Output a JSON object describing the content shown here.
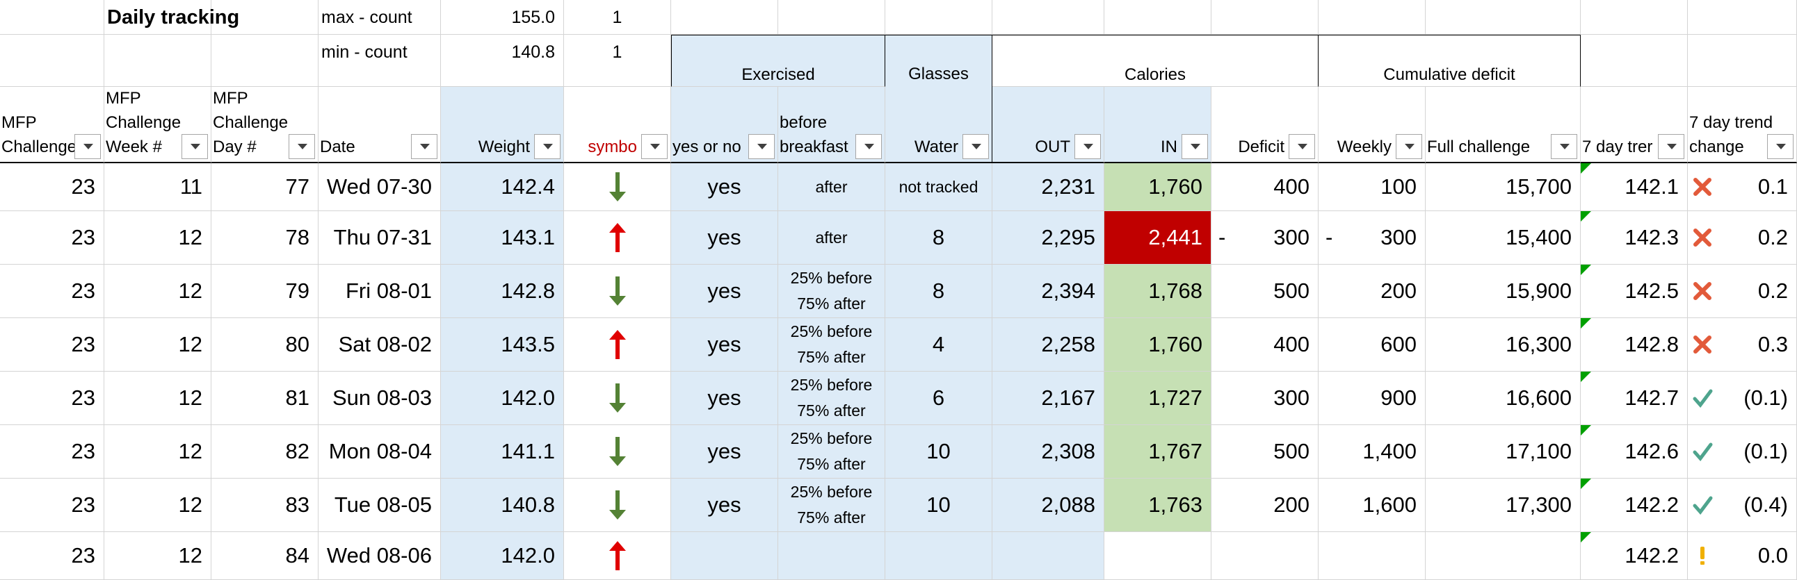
{
  "title": "Daily tracking",
  "summary": [
    {
      "label": "max - count",
      "value": "155.0",
      "count": "1"
    },
    {
      "label": "min - count",
      "value": "140.8",
      "count": "1"
    }
  ],
  "groups": {
    "exercised": "Exercised",
    "glasses": "Glasses",
    "calories": "Calories",
    "cumulative": "Cumulative deficit"
  },
  "headers": {
    "challenge": [
      "MFP",
      "Challenge"
    ],
    "week": [
      "MFP",
      "Challenge",
      "Week #"
    ],
    "day": [
      "MFP",
      "Challenge",
      "Day #"
    ],
    "date": "Date",
    "weight": "Weight",
    "symbol": "symbo",
    "yesno": "yes or no",
    "before": [
      "before",
      "breakfast"
    ],
    "water": "Water",
    "out": "OUT",
    "in": "IN",
    "deficit": "Deficit",
    "weekly": "Weekly",
    "full": "Full challenge",
    "trend": "7 day trer",
    "change": [
      "7 day trend",
      "change"
    ]
  },
  "colors": {
    "header_red": "#c00000",
    "up_arrow": "#e00000",
    "down_arrow": "#548235",
    "x_mark": "#e25a3a",
    "check": "#4ea48d",
    "warn": "#f0b000",
    "blue_fill": "#ddebf7",
    "green_fill": "#c6e0b4",
    "red_fill": "#c00000"
  },
  "rows": [
    {
      "challenge": "23",
      "week": "11",
      "day": "77",
      "date": "Wed 07-30",
      "weight": "142.4",
      "symbol": "down-arrow-icon",
      "exercised": "yes",
      "timing": [
        "after"
      ],
      "water": "not tracked",
      "out": "2,231",
      "in": "1,760",
      "in_status": "good",
      "deficit": "400",
      "deficit_neg": "",
      "weekly": "100",
      "weekly_neg": "",
      "full": "15,700",
      "trend": "142.1",
      "trend_icon": "x-mark-icon",
      "change": "0.1"
    },
    {
      "challenge": "23",
      "week": "12",
      "day": "78",
      "date": "Thu 07-31",
      "weight": "143.1",
      "symbol": "up-arrow-icon",
      "exercised": "yes",
      "timing": [
        "after"
      ],
      "water": "8",
      "out": "2,295",
      "in": "2,441",
      "in_status": "bad",
      "deficit": "300",
      "deficit_neg": "-",
      "weekly": "300",
      "weekly_neg": "-",
      "full": "15,400",
      "trend": "142.3",
      "trend_icon": "x-mark-icon",
      "change": "0.2"
    },
    {
      "challenge": "23",
      "week": "12",
      "day": "79",
      "date": "Fri 08-01",
      "weight": "142.8",
      "symbol": "down-arrow-icon",
      "exercised": "yes",
      "timing": [
        "25% before",
        "75% after"
      ],
      "water": "8",
      "out": "2,394",
      "in": "1,768",
      "in_status": "good",
      "deficit": "500",
      "deficit_neg": "",
      "weekly": "200",
      "weekly_neg": "",
      "full": "15,900",
      "trend": "142.5",
      "trend_icon": "x-mark-icon",
      "change": "0.2"
    },
    {
      "challenge": "23",
      "week": "12",
      "day": "80",
      "date": "Sat 08-02",
      "weight": "143.5",
      "symbol": "up-arrow-icon",
      "exercised": "yes",
      "timing": [
        "25% before",
        "75% after"
      ],
      "water": "4",
      "out": "2,258",
      "in": "1,760",
      "in_status": "good",
      "deficit": "400",
      "deficit_neg": "",
      "weekly": "600",
      "weekly_neg": "",
      "full": "16,300",
      "trend": "142.8",
      "trend_icon": "x-mark-icon",
      "change": "0.3"
    },
    {
      "challenge": "23",
      "week": "12",
      "day": "81",
      "date": "Sun 08-03",
      "weight": "142.0",
      "symbol": "down-arrow-icon",
      "exercised": "yes",
      "timing": [
        "25% before",
        "75% after"
      ],
      "water": "6",
      "out": "2,167",
      "in": "1,727",
      "in_status": "good",
      "deficit": "300",
      "deficit_neg": "",
      "weekly": "900",
      "weekly_neg": "",
      "full": "16,600",
      "trend": "142.7",
      "trend_icon": "check-icon",
      "change": "(0.1)"
    },
    {
      "challenge": "23",
      "week": "12",
      "day": "82",
      "date": "Mon 08-04",
      "weight": "141.1",
      "symbol": "down-arrow-icon",
      "exercised": "yes",
      "timing": [
        "25% before",
        "75% after"
      ],
      "water": "10",
      "out": "2,308",
      "in": "1,767",
      "in_status": "good",
      "deficit": "500",
      "deficit_neg": "",
      "weekly": "1,400",
      "weekly_neg": "",
      "full": "17,100",
      "trend": "142.6",
      "trend_icon": "check-icon",
      "change": "(0.1)"
    },
    {
      "challenge": "23",
      "week": "12",
      "day": "83",
      "date": "Tue 08-05",
      "weight": "140.8",
      "symbol": "down-arrow-icon",
      "exercised": "yes",
      "timing": [
        "25% before",
        "75% after"
      ],
      "water": "10",
      "out": "2,088",
      "in": "1,763",
      "in_status": "good",
      "deficit": "200",
      "deficit_neg": "",
      "weekly": "1,600",
      "weekly_neg": "",
      "full": "17,300",
      "trend": "142.2",
      "trend_icon": "check-icon",
      "change": "(0.4)"
    },
    {
      "challenge": "23",
      "week": "12",
      "day": "84",
      "date": "Wed 08-06",
      "weight": "142.0",
      "symbol": "up-arrow-icon",
      "exercised": "",
      "timing": [],
      "water": "",
      "out": "",
      "in": "",
      "in_status": "empty",
      "deficit": "",
      "deficit_neg": "",
      "weekly": "",
      "weekly_neg": "",
      "full": "",
      "trend": "142.2",
      "trend_icon": "warning-icon",
      "change": "0.0"
    }
  ]
}
